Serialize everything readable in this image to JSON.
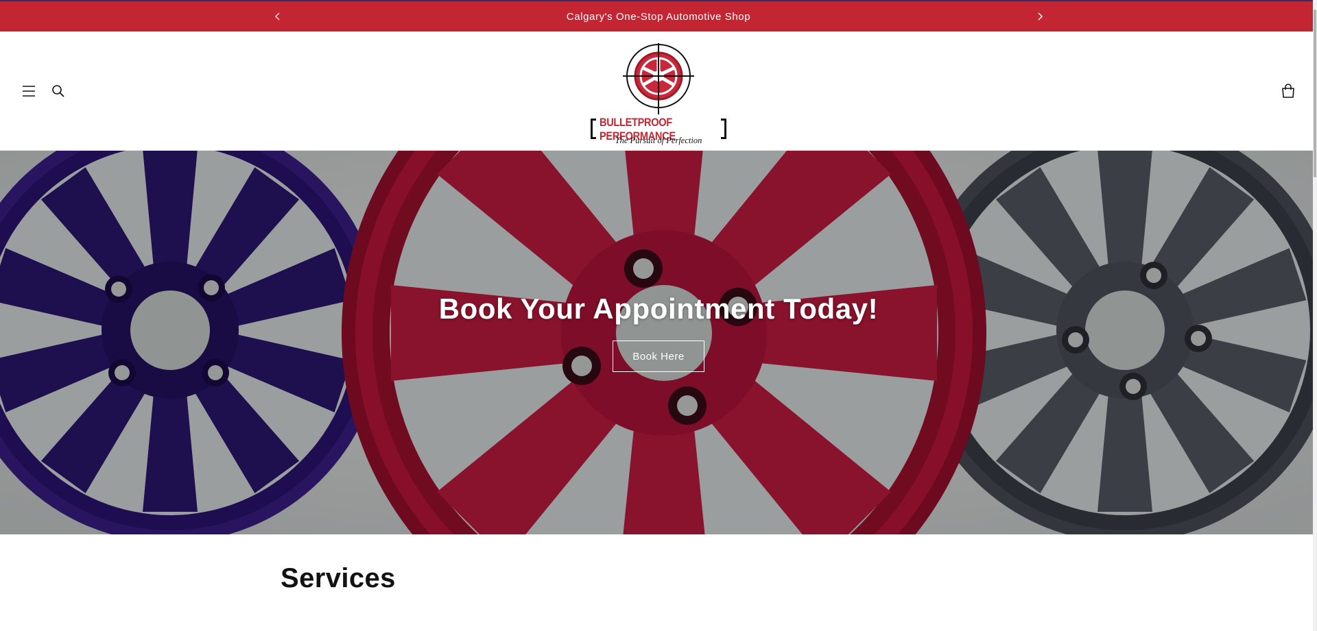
{
  "announcement": {
    "text": "Calgary's One-Stop Automotive Shop",
    "prev_icon": "chevron-left-icon",
    "next_icon": "chevron-right-icon"
  },
  "header": {
    "menu_icon": "hamburger-menu-icon",
    "search_icon": "search-icon",
    "cart_icon": "cart-icon",
    "logo": {
      "brand": "BULLETPROOF PERFORMANCE",
      "tagline": "The Pursuit of Perfection"
    }
  },
  "hero": {
    "title": "Book Your Appointment Today!",
    "button_label": "Book Here"
  },
  "services": {
    "title": "Services"
  },
  "colors": {
    "announcement_bg": "#c32533",
    "brand_red": "#c32533",
    "text": "#121212",
    "white": "#ffffff"
  }
}
